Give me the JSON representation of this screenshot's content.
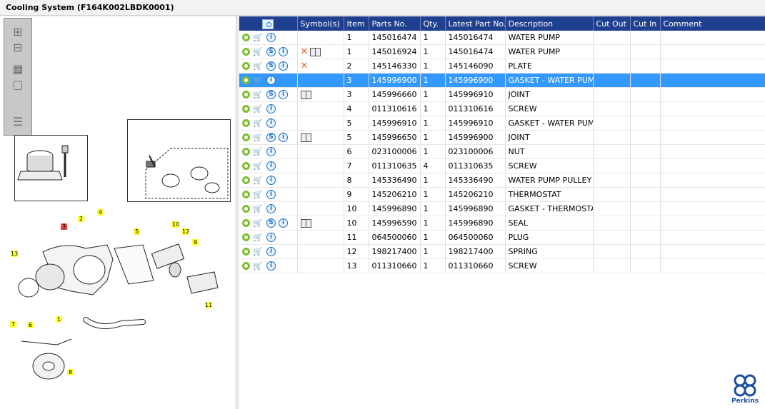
{
  "window": {
    "title": "Cooling System (F164K002LBDK0001)"
  },
  "diagram": {
    "callouts": [
      "1",
      "2",
      "3",
      "4",
      "5",
      "6",
      "7",
      "8",
      "9",
      "10",
      "11",
      "12",
      "13"
    ]
  },
  "grid": {
    "columns": {
      "symbols": "Symbol(s)",
      "item": "Item",
      "parts_no": "Parts No.",
      "qty": "Qty.",
      "latest": "Latest Part No.",
      "description": "Description",
      "cut_out": "Cut Out",
      "cut_in": "Cut In",
      "comment": "Comment"
    },
    "rows": [
      {
        "item": "1",
        "parts_no": "145016474",
        "qty": "1",
        "latest": "145016474",
        "description": "WATER PUMP",
        "s": false,
        "x": false,
        "book": false
      },
      {
        "item": "1",
        "parts_no": "145016924",
        "qty": "1",
        "latest": "145016474",
        "description": "WATER PUMP",
        "s": true,
        "x": true,
        "book": true
      },
      {
        "item": "2",
        "parts_no": "145146330",
        "qty": "1",
        "latest": "145146090",
        "description": "PLATE",
        "s": true,
        "x": true,
        "book": false
      },
      {
        "item": "3",
        "parts_no": "145996900",
        "qty": "1",
        "latest": "145996900",
        "description": "GASKET - WATER PUMP",
        "s": false,
        "x": false,
        "book": false,
        "selected": true
      },
      {
        "item": "3",
        "parts_no": "145996660",
        "qty": "1",
        "latest": "145996910",
        "description": "JOINT",
        "s": true,
        "x": false,
        "book": true
      },
      {
        "item": "4",
        "parts_no": "011310616",
        "qty": "1",
        "latest": "011310616",
        "description": "SCREW",
        "s": false,
        "x": false,
        "book": false
      },
      {
        "item": "5",
        "parts_no": "145996910",
        "qty": "1",
        "latest": "145996910",
        "description": "GASKET - WATER PUMP",
        "s": false,
        "x": false,
        "book": false
      },
      {
        "item": "5",
        "parts_no": "145996650",
        "qty": "1",
        "latest": "145996900",
        "description": "JOINT",
        "s": true,
        "x": false,
        "book": true
      },
      {
        "item": "6",
        "parts_no": "023100006",
        "qty": "1",
        "latest": "023100006",
        "description": "NUT",
        "s": false,
        "x": false,
        "book": false
      },
      {
        "item": "7",
        "parts_no": "011310635",
        "qty": "4",
        "latest": "011310635",
        "description": "SCREW",
        "s": false,
        "x": false,
        "book": false
      },
      {
        "item": "8",
        "parts_no": "145336490",
        "qty": "1",
        "latest": "145336490",
        "description": "WATER PUMP PULLEY",
        "s": false,
        "x": false,
        "book": false
      },
      {
        "item": "9",
        "parts_no": "145206210",
        "qty": "1",
        "latest": "145206210",
        "description": "THERMOSTAT",
        "s": false,
        "x": false,
        "book": false
      },
      {
        "item": "10",
        "parts_no": "145996890",
        "qty": "1",
        "latest": "145996890",
        "description": "GASKET - THERMOSTAT",
        "s": false,
        "x": false,
        "book": false
      },
      {
        "item": "10",
        "parts_no": "145996590",
        "qty": "1",
        "latest": "145996890",
        "description": "SEAL",
        "s": true,
        "x": false,
        "book": true
      },
      {
        "item": "11",
        "parts_no": "064500060",
        "qty": "1",
        "latest": "064500060",
        "description": "PLUG",
        "s": false,
        "x": false,
        "book": false
      },
      {
        "item": "12",
        "parts_no": "198217400",
        "qty": "1",
        "latest": "198217400",
        "description": "SPRING",
        "s": false,
        "x": false,
        "book": false
      },
      {
        "item": "13",
        "parts_no": "011310660",
        "qty": "1",
        "latest": "011310660",
        "description": "SCREW",
        "s": false,
        "x": false,
        "book": false
      }
    ]
  },
  "brand": {
    "name": "Perkins",
    "color": "#1a4fa0"
  },
  "colors": {
    "header_bg": "#1f3f8f",
    "selected_row": "#3399ff",
    "callout": "#ffff33",
    "callout_highlight": "#e84a4a"
  }
}
